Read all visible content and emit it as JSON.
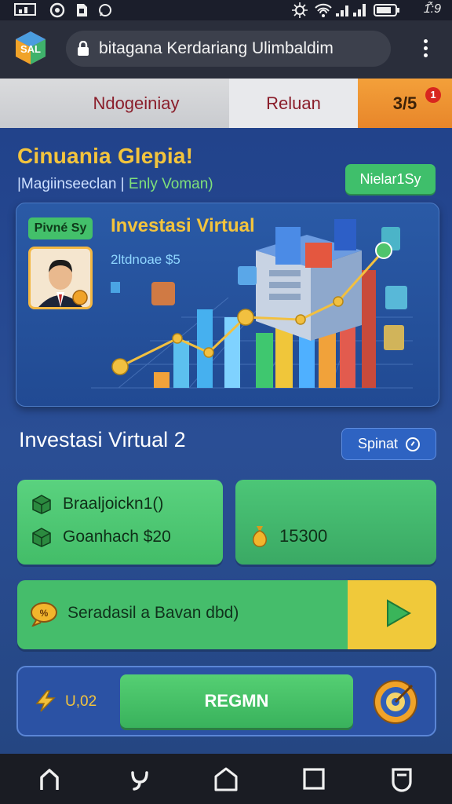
{
  "status_bar": {
    "time": "1̂:̃9",
    "icons": [
      "image-icon",
      "circle-icon",
      "sd-icon",
      "whatsapp-icon",
      "bluetooth-icon",
      "wifi-icon",
      "signal-icon",
      "battery-icon"
    ]
  },
  "browser": {
    "url": "bitagana Kerdariang Ulimbaldim"
  },
  "tabs": [
    {
      "label": "Ndogeiniay"
    },
    {
      "label": "Reluan"
    },
    {
      "label": "3/5",
      "badge": "1"
    }
  ],
  "welcome": {
    "title": "Cinuania Glepia!",
    "subtitle_main": "|Magiinseeclan | ",
    "subtitle_highlight": "Enly Voman)",
    "action_label": "Nielar1Sy"
  },
  "hero": {
    "badge": "Pivné Sy",
    "title": "Investasi Virtual",
    "subtitle": "2ltdnoae $5"
  },
  "section": {
    "title": "Investasi Virtual 2",
    "action_label": "Spinat"
  },
  "cards": {
    "left_line1": "Braaljoickn1()",
    "left_line2": "Goanhach $20",
    "right_value": "15300"
  },
  "wide_card": {
    "label": "Seradasil a Bavan dbd)"
  },
  "bottom": {
    "value": "U,02",
    "button_label": "REGMN"
  },
  "colors": {
    "gold": "#f3c43d",
    "green": "#43bd68",
    "blue": "#2b52a4",
    "orange": "#e8862a"
  }
}
